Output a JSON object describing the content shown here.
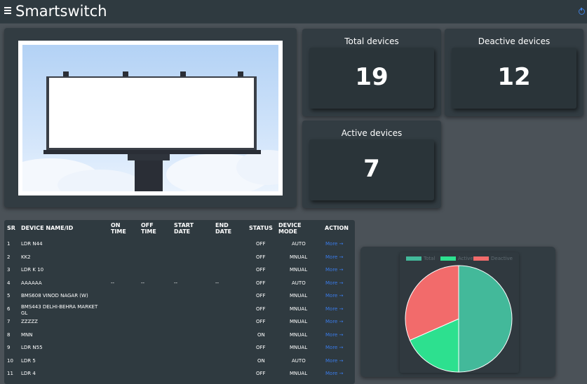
{
  "header": {
    "title": "Smartswitch",
    "menu_icon": "hamburger-menu-icon",
    "power_icon": "power-icon"
  },
  "colors": {
    "topbar": "#2f3a40",
    "panel": "#323c42",
    "background": "#4b5258",
    "link": "#3a7be8",
    "total": "#43b99a",
    "active": "#2de08f",
    "deactive": "#f26b6b"
  },
  "stats": {
    "total": {
      "label": "Total devices",
      "value": "19"
    },
    "deactive": {
      "label": "Deactive devices",
      "value": "12"
    },
    "active": {
      "label": "Active devices",
      "value": "7"
    }
  },
  "table": {
    "headers": {
      "sr": "SR",
      "name": "DEVICE NAME/ID",
      "on_time_1": "ON",
      "on_time_2": "TIME",
      "off_time_1": "OFF",
      "off_time_2": "TIME",
      "start_date_1": "START",
      "start_date_2": "DATE",
      "end_date_1": "END",
      "end_date_2": "DATE",
      "status": "STATUS",
      "mode_1": "DEVICE",
      "mode_2": "MODE",
      "action": "ACTION"
    },
    "rows": [
      {
        "sr": "1",
        "name": "LDR N44",
        "on": "",
        "off": "",
        "start": "",
        "end": "",
        "status": "OFF",
        "mode": "AUTO",
        "action": "More →"
      },
      {
        "sr": "2",
        "name": "KK2",
        "on": "",
        "off": "",
        "start": "",
        "end": "",
        "status": "OFF",
        "mode": "MNUAL",
        "action": "More →"
      },
      {
        "sr": "3",
        "name": "LDR K 10",
        "on": "",
        "off": "",
        "start": "",
        "end": "",
        "status": "OFF",
        "mode": "MNUAL",
        "action": "More →"
      },
      {
        "sr": "4",
        "name": "AAAAAA",
        "on": "--",
        "off": "--",
        "start": "--",
        "end": "--",
        "status": "OFF",
        "mode": "AUTO",
        "action": "More →"
      },
      {
        "sr": "5",
        "name": "BMS608 VINOD NAGAR (W)",
        "on": "",
        "off": "",
        "start": "",
        "end": "",
        "status": "OFF",
        "mode": "MNUAL",
        "action": "More →"
      },
      {
        "sr": "6",
        "name": "BMS443 DELHI-BEHRA MARKET",
        "name2": "GL",
        "on": "",
        "off": "",
        "start": "",
        "end": "",
        "status": "OFF",
        "mode": "MNUAL",
        "action": "More →"
      },
      {
        "sr": "7",
        "name": "ZZZZZ",
        "on": "",
        "off": "",
        "start": "",
        "end": "",
        "status": "OFF",
        "mode": "MNUAL",
        "action": "More →"
      },
      {
        "sr": "8",
        "name": "MNN",
        "on": "",
        "off": "",
        "start": "",
        "end": "",
        "status": "ON",
        "mode": "MNUAL",
        "action": "More →"
      },
      {
        "sr": "9",
        "name": "LDR N55",
        "on": "",
        "off": "",
        "start": "",
        "end": "",
        "status": "OFF",
        "mode": "MNUAL",
        "action": "More →"
      },
      {
        "sr": "10",
        "name": "LDR 5",
        "on": "",
        "off": "",
        "start": "",
        "end": "",
        "status": "ON",
        "mode": "AUTO",
        "action": "More →"
      },
      {
        "sr": "11",
        "name": "LDR 4",
        "on": "",
        "off": "",
        "start": "",
        "end": "",
        "status": "OFF",
        "mode": "MNUAL",
        "action": "More →"
      }
    ]
  },
  "chart_data": {
    "type": "pie",
    "legend": [
      "Total",
      "Active",
      "Deactive"
    ],
    "values": [
      19,
      7,
      12
    ],
    "colors": [
      "#43b99a",
      "#2de08f",
      "#f26b6b"
    ],
    "legend_position": "top"
  }
}
